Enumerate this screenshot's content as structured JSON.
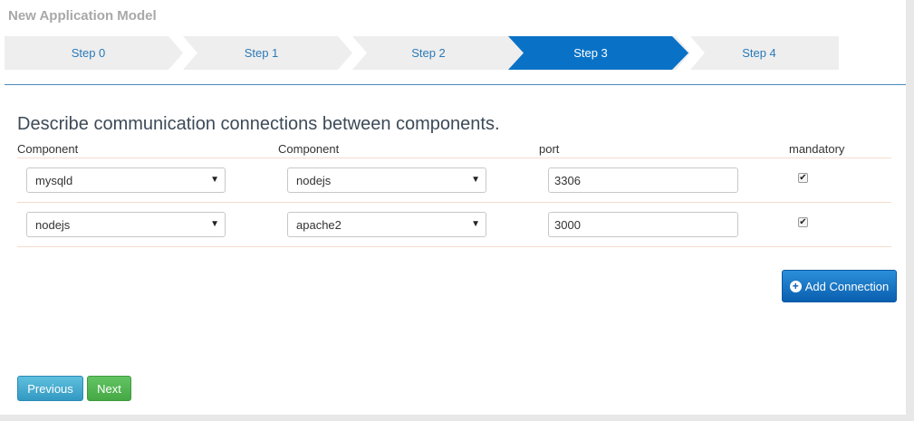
{
  "title": "New Application Model",
  "steps": [
    {
      "label": "Step 0",
      "active": false
    },
    {
      "label": "Step 1",
      "active": false
    },
    {
      "label": "Step 2",
      "active": false
    },
    {
      "label": "Step 3",
      "active": true
    },
    {
      "label": "Step 4",
      "active": false
    }
  ],
  "heading": "Describe communication connections between components.",
  "columns": {
    "component_a": "Component",
    "component_b": "Component",
    "port": "port",
    "mandatory": "mandatory"
  },
  "connections": [
    {
      "from": "mysqld",
      "to": "nodejs",
      "port": "3306",
      "mandatory": true
    },
    {
      "from": "nodejs",
      "to": "apache2",
      "port": "3000",
      "mandatory": true
    }
  ],
  "buttons": {
    "add_connection": "Add Connection",
    "previous": "Previous",
    "next": "Next"
  },
  "colors": {
    "active_step": "#0a72c6",
    "step_text": "#2a7ab8",
    "primary": "#0a5fb0",
    "info": "#4bb1d3",
    "success": "#55b655"
  }
}
